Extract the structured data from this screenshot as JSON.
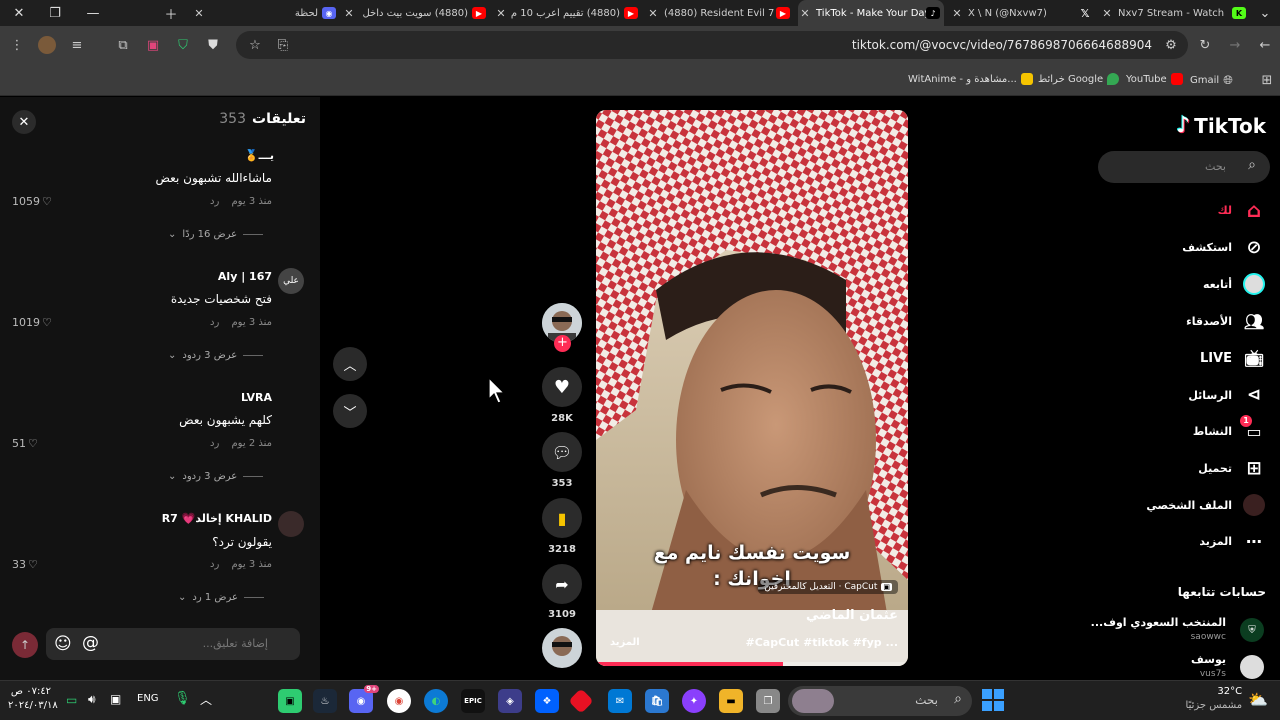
{
  "browser": {
    "tabs": [
      {
        "title": "لحظة"
      },
      {
        "title": "(4880) سويت بيت داخل"
      },
      {
        "title": "(4880) تقييم أعرب 10 م"
      },
      {
        "title": "(4880) Resident Evil 7"
      },
      {
        "title": "TikTok - Make Your Day"
      },
      {
        "title": "X \\ N (@Nxvw7)"
      },
      {
        "title": "Nxv7 Stream - Watch"
      }
    ],
    "url": "tiktok.com/@vocvc/video/7678698706664688904",
    "bookmarks": [
      "WitAnime - مشاهدة و...",
      "خرائط Google",
      "YouTube",
      "Gmail"
    ]
  },
  "comments": {
    "title": "تعليقات",
    "count": "353",
    "placeholder": "إضافة تعليق...",
    "items": [
      {
        "name": "يـــ🏅",
        "text": "ماشاءالله تشبهون بعض",
        "time": "منذ 3 يوم",
        "reply": "رد",
        "likes": "1059",
        "view": "عرض 16 ردًا"
      },
      {
        "name": "Aly | 167",
        "text": "فتح شخصيات جديدة",
        "time": "منذ 3 يوم",
        "reply": "رد",
        "likes": "1019",
        "view": "عرض 3 ردود"
      },
      {
        "name": "LVRA",
        "text": "كلهم يشبهون بعض",
        "time": "منذ 2 يوم",
        "reply": "رد",
        "likes": "51",
        "view": "عرض 3 ردود"
      },
      {
        "name": "R7 💗إخالد KHALID",
        "text": "يقولون ترد؟",
        "time": "منذ 3 يوم",
        "reply": "رد",
        "likes": "33",
        "view": "عرض 1 رد"
      }
    ],
    "avatar_label": "علي"
  },
  "video": {
    "caption": "سويت نفسك نايم مع اخوانك :",
    "capcut": "CapCut · التعديل كالمحترفين",
    "author": "عثمان الماضي",
    "tags": "#CapCut #tiktok #fyp ...",
    "more": "المزيد",
    "progress": 0.6
  },
  "actions": {
    "likes": "28K",
    "comments": "353",
    "saves": "3218",
    "shares": "3109"
  },
  "sidebar": {
    "logo": "TikTok",
    "search_placeholder": "بحث",
    "items": [
      "لك",
      "استكشف",
      "أتابعه",
      "الأصدقاء",
      "LIVE",
      "الرسائل",
      "النشاط",
      "تحميل",
      "الملف الشخصي",
      "المزيد"
    ],
    "activity_badge": "1",
    "following_title": "حسابات تتابعها",
    "following": [
      {
        "name": "المنتخب السعودي اوف...",
        "handle": "saowwc"
      },
      {
        "name": "يوسف",
        "handle": "vus7s"
      }
    ]
  },
  "taskbar": {
    "weather_temp": "32°C",
    "weather_desc": "مشمس جزئيًا",
    "search": "بحث",
    "lang": "ENG",
    "time": "٠٧:٤٢ ص",
    "date": "٢٠٢٤/٠٣/١٨",
    "discord_badge": "9+"
  }
}
